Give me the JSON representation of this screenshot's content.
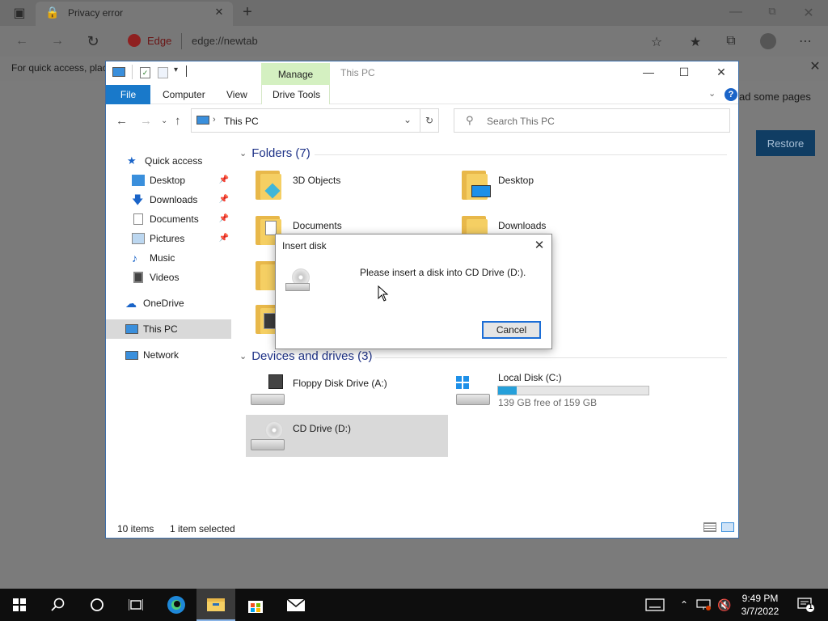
{
  "edge": {
    "tab_title": "Privacy error",
    "brand": "Edge",
    "address": "edge://newtab",
    "infobar_text": "For quick access, plac",
    "restore_text": "ad some pages",
    "restore_button": "Restore"
  },
  "explorer": {
    "title": "This PC",
    "manage_tab": "Manage",
    "ribbon_tabs": {
      "file": "File",
      "computer": "Computer",
      "view": "View",
      "drive_tools": "Drive Tools"
    },
    "address": "This PC",
    "search_placeholder": "Search This PC",
    "sidebar": {
      "quick_access": "Quick access",
      "desktop": "Desktop",
      "downloads": "Downloads",
      "documents": "Documents",
      "pictures": "Pictures",
      "music": "Music",
      "videos": "Videos",
      "onedrive": "OneDrive",
      "this_pc": "This PC",
      "network": "Network"
    },
    "folders_header": "Folders (7)",
    "folders": {
      "objects3d": "3D Objects",
      "desktop": "Desktop",
      "documents": "Documents",
      "downloads": "Downloads"
    },
    "drives_header": "Devices and drives (3)",
    "drives": {
      "floppy": "Floppy Disk Drive (A:)",
      "local": "Local Disk (C:)",
      "local_free": "139 GB free of 159 GB",
      "local_used_fraction": 0.126,
      "cd": "CD Drive (D:)"
    },
    "status": {
      "items": "10 items",
      "selected": "1 item selected"
    }
  },
  "dialog": {
    "title": "Insert disk",
    "message": "Please insert a disk into CD Drive (D:).",
    "cancel": "Cancel"
  },
  "taskbar": {
    "time": "9:49 PM",
    "date": "3/7/2022",
    "notification_count": "1"
  },
  "colors": {
    "accent": "#1979ca",
    "manage_tab": "#d4f0c1",
    "progress": "#26a0da",
    "restore_button": "#103d63"
  }
}
